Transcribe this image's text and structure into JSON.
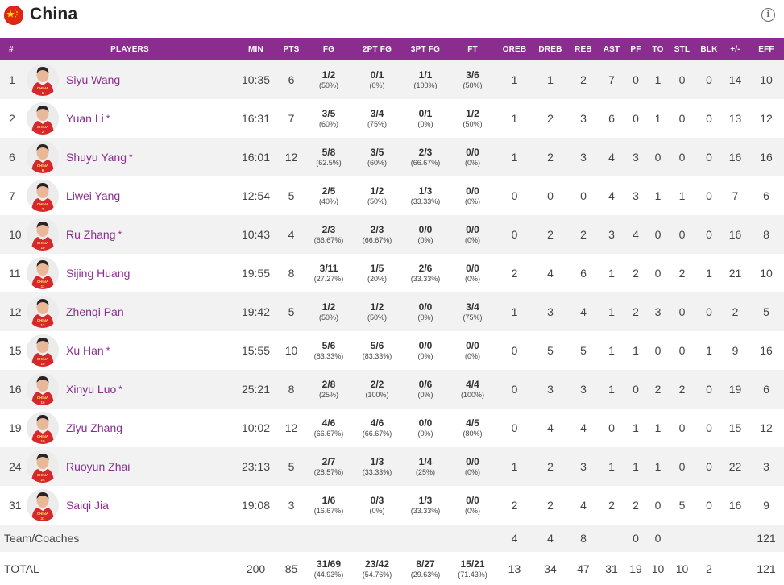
{
  "team": {
    "name": "China"
  },
  "columns": [
    "#",
    "PLAYERS",
    "MIN",
    "PTS",
    "FG",
    "2PT FG",
    "3PT FG",
    "FT",
    "OREB",
    "DREB",
    "REB",
    "AST",
    "PF",
    "TO",
    "STL",
    "BLK",
    "+/-",
    "EFF"
  ],
  "players": [
    {
      "num": "1",
      "name": "Siyu Wang",
      "starter": "",
      "min": "10:35",
      "pts": "6",
      "fg": "1/2",
      "fg_pct": "(50%)",
      "fg2": "0/1",
      "fg2_pct": "(0%)",
      "fg3": "1/1",
      "fg3_pct": "(100%)",
      "ft": "3/6",
      "ft_pct": "(50%)",
      "oreb": "1",
      "dreb": "1",
      "reb": "2",
      "ast": "7",
      "pf": "0",
      "to": "1",
      "stl": "0",
      "blk": "0",
      "pm": "14",
      "eff": "10",
      "jersey": "5"
    },
    {
      "num": "2",
      "name": "Yuan Li",
      "starter": "*",
      "min": "16:31",
      "pts": "7",
      "fg": "3/5",
      "fg_pct": "(60%)",
      "fg2": "3/4",
      "fg2_pct": "(75%)",
      "fg3": "0/1",
      "fg3_pct": "(0%)",
      "ft": "1/2",
      "ft_pct": "(50%)",
      "oreb": "1",
      "dreb": "2",
      "reb": "3",
      "ast": "6",
      "pf": "0",
      "to": "1",
      "stl": "0",
      "blk": "0",
      "pm": "13",
      "eff": "12",
      "jersey": "2"
    },
    {
      "num": "6",
      "name": "Shuyu Yang",
      "starter": "*",
      "min": "16:01",
      "pts": "12",
      "fg": "5/8",
      "fg_pct": "(62.5%)",
      "fg2": "3/5",
      "fg2_pct": "(60%)",
      "fg3": "2/3",
      "fg3_pct": "(66.67%)",
      "ft": "0/0",
      "ft_pct": "(0%)",
      "oreb": "1",
      "dreb": "2",
      "reb": "3",
      "ast": "4",
      "pf": "3",
      "to": "0",
      "stl": "0",
      "blk": "0",
      "pm": "16",
      "eff": "16",
      "jersey": "6"
    },
    {
      "num": "7",
      "name": "Liwei Yang",
      "starter": "",
      "min": "12:54",
      "pts": "5",
      "fg": "2/5",
      "fg_pct": "(40%)",
      "fg2": "1/2",
      "fg2_pct": "(50%)",
      "fg3": "1/3",
      "fg3_pct": "(33.33%)",
      "ft": "0/0",
      "ft_pct": "(0%)",
      "oreb": "0",
      "dreb": "0",
      "reb": "0",
      "ast": "4",
      "pf": "3",
      "to": "1",
      "stl": "1",
      "blk": "0",
      "pm": "7",
      "eff": "6",
      "jersey": "7"
    },
    {
      "num": "10",
      "name": "Ru Zhang",
      "starter": "*",
      "min": "10:43",
      "pts": "4",
      "fg": "2/3",
      "fg_pct": "(66.67%)",
      "fg2": "2/3",
      "fg2_pct": "(66.67%)",
      "fg3": "0/0",
      "fg3_pct": "(0%)",
      "ft": "0/0",
      "ft_pct": "(0%)",
      "oreb": "0",
      "dreb": "2",
      "reb": "2",
      "ast": "3",
      "pf": "4",
      "to": "0",
      "stl": "0",
      "blk": "0",
      "pm": "16",
      "eff": "8",
      "jersey": "10"
    },
    {
      "num": "11",
      "name": "Sijing Huang",
      "starter": "",
      "min": "19:55",
      "pts": "8",
      "fg": "3/11",
      "fg_pct": "(27.27%)",
      "fg2": "1/5",
      "fg2_pct": "(20%)",
      "fg3": "2/6",
      "fg3_pct": "(33.33%)",
      "ft": "0/0",
      "ft_pct": "(0%)",
      "oreb": "2",
      "dreb": "4",
      "reb": "6",
      "ast": "1",
      "pf": "2",
      "to": "0",
      "stl": "2",
      "blk": "1",
      "pm": "21",
      "eff": "10",
      "jersey": "11"
    },
    {
      "num": "12",
      "name": "Zhenqi Pan",
      "starter": "",
      "min": "19:42",
      "pts": "5",
      "fg": "1/2",
      "fg_pct": "(50%)",
      "fg2": "1/2",
      "fg2_pct": "(50%)",
      "fg3": "0/0",
      "fg3_pct": "(0%)",
      "ft": "3/4",
      "ft_pct": "(75%)",
      "oreb": "1",
      "dreb": "3",
      "reb": "4",
      "ast": "1",
      "pf": "2",
      "to": "3",
      "stl": "0",
      "blk": "0",
      "pm": "2",
      "eff": "5",
      "jersey": "12"
    },
    {
      "num": "15",
      "name": "Xu Han",
      "starter": "*",
      "min": "15:55",
      "pts": "10",
      "fg": "5/6",
      "fg_pct": "(83.33%)",
      "fg2": "5/6",
      "fg2_pct": "(83.33%)",
      "fg3": "0/0",
      "fg3_pct": "(0%)",
      "ft": "0/0",
      "ft_pct": "(0%)",
      "oreb": "0",
      "dreb": "5",
      "reb": "5",
      "ast": "1",
      "pf": "1",
      "to": "0",
      "stl": "0",
      "blk": "1",
      "pm": "9",
      "eff": "16",
      "jersey": "15"
    },
    {
      "num": "16",
      "name": "Xinyu Luo",
      "starter": "*",
      "min": "25:21",
      "pts": "8",
      "fg": "2/8",
      "fg_pct": "(25%)",
      "fg2": "2/2",
      "fg2_pct": "(100%)",
      "fg3": "0/6",
      "fg3_pct": "(0%)",
      "ft": "4/4",
      "ft_pct": "(100%)",
      "oreb": "0",
      "dreb": "3",
      "reb": "3",
      "ast": "1",
      "pf": "0",
      "to": "2",
      "stl": "2",
      "blk": "0",
      "pm": "19",
      "eff": "6",
      "jersey": "16"
    },
    {
      "num": "19",
      "name": "Ziyu Zhang",
      "starter": "",
      "min": "10:02",
      "pts": "12",
      "fg": "4/6",
      "fg_pct": "(66.67%)",
      "fg2": "4/6",
      "fg2_pct": "(66.67%)",
      "fg3": "0/0",
      "fg3_pct": "(0%)",
      "ft": "4/5",
      "ft_pct": "(80%)",
      "oreb": "0",
      "dreb": "4",
      "reb": "4",
      "ast": "0",
      "pf": "1",
      "to": "1",
      "stl": "0",
      "blk": "0",
      "pm": "15",
      "eff": "12",
      "jersey": "19"
    },
    {
      "num": "24",
      "name": "Ruoyun Zhai",
      "starter": "",
      "min": "23:13",
      "pts": "5",
      "fg": "2/7",
      "fg_pct": "(28.57%)",
      "fg2": "1/3",
      "fg2_pct": "(33.33%)",
      "fg3": "1/4",
      "fg3_pct": "(25%)",
      "ft": "0/0",
      "ft_pct": "(0%)",
      "oreb": "1",
      "dreb": "2",
      "reb": "3",
      "ast": "1",
      "pf": "1",
      "to": "1",
      "stl": "0",
      "blk": "0",
      "pm": "22",
      "eff": "3",
      "jersey": "24"
    },
    {
      "num": "31",
      "name": "Saiqi Jia",
      "starter": "",
      "min": "19:08",
      "pts": "3",
      "fg": "1/6",
      "fg_pct": "(16.67%)",
      "fg2": "0/3",
      "fg2_pct": "(0%)",
      "fg3": "1/3",
      "fg3_pct": "(33.33%)",
      "ft": "0/0",
      "ft_pct": "(0%)",
      "oreb": "2",
      "dreb": "2",
      "reb": "4",
      "ast": "2",
      "pf": "2",
      "to": "0",
      "stl": "5",
      "blk": "0",
      "pm": "16",
      "eff": "9",
      "jersey": "31"
    }
  ],
  "team_row": {
    "label": "Team/Coaches",
    "oreb": "4",
    "dreb": "4",
    "reb": "8",
    "pf": "0",
    "to": "0",
    "eff": "121"
  },
  "total_row": {
    "label": "TOTAL",
    "min": "200",
    "pts": "85",
    "fg": "31/69",
    "fg_pct": "(44.93%)",
    "fg2": "23/42",
    "fg2_pct": "(54.76%)",
    "fg3": "8/27",
    "fg3_pct": "(29.63%)",
    "ft": "15/21",
    "ft_pct": "(71.43%)",
    "oreb": "13",
    "dreb": "34",
    "reb": "47",
    "ast": "31",
    "pf": "19",
    "to": "10",
    "stl": "10",
    "blk": "2",
    "pm": "",
    "eff": "121"
  },
  "icons": {
    "flag": "china-flag-icon",
    "info": "info-icon"
  },
  "colors": {
    "header_bg": "#8a2d8f",
    "link": "#8a2d8f",
    "row_alt": "#f2f2f2",
    "flag_red": "#de2910",
    "flag_yellow": "#ffde00",
    "jersey_red": "#d7262c"
  }
}
